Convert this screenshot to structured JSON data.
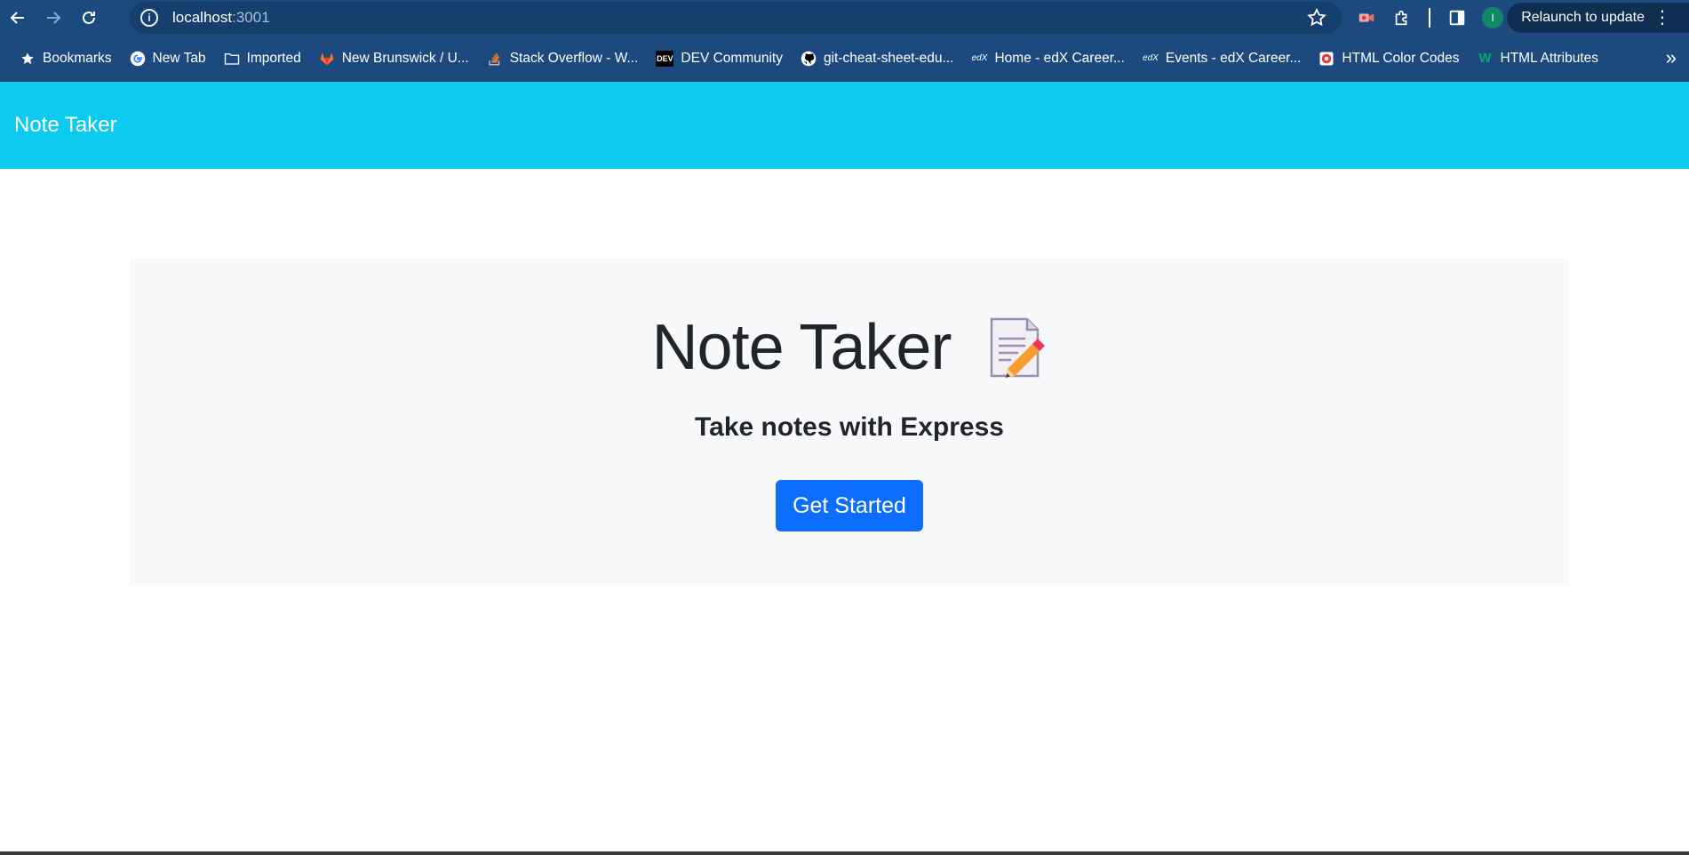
{
  "browser": {
    "url_host": "localhost",
    "url_port": ":3001",
    "profile_initial": "I",
    "relaunch_label": "Relaunch to update",
    "more_menu_glyph": "⋮"
  },
  "bookmarks": [
    {
      "label": "Bookmarks",
      "icon": "star-icon"
    },
    {
      "label": "New Tab",
      "icon": "google-icon"
    },
    {
      "label": "Imported",
      "icon": "folder-icon"
    },
    {
      "label": "New Brunswick / U...",
      "icon": "gitlab-icon"
    },
    {
      "label": "Stack Overflow - W...",
      "icon": "stackoverflow-icon"
    },
    {
      "label": "DEV Community",
      "icon": "dev-icon"
    },
    {
      "label": "git-cheat-sheet-edu...",
      "icon": "github-icon"
    },
    {
      "label": "Home - edX Career...",
      "icon": "edx-icon"
    },
    {
      "label": "Events - edX Career...",
      "icon": "edx-icon"
    },
    {
      "label": "HTML Color Codes",
      "icon": "htmlcolor-icon"
    },
    {
      "label": "HTML Attributes",
      "icon": "w-icon"
    }
  ],
  "navbar": {
    "brand": "Note Taker"
  },
  "hero": {
    "title": "Note Taker",
    "subtitle": "Take notes with Express",
    "cta_label": "Get Started"
  },
  "colors": {
    "browser_chrome": "#1c4a7e",
    "navbar": "#0dcaf0",
    "jumbotron": "#f8f9fa",
    "primary_button": "#0d6efd"
  }
}
